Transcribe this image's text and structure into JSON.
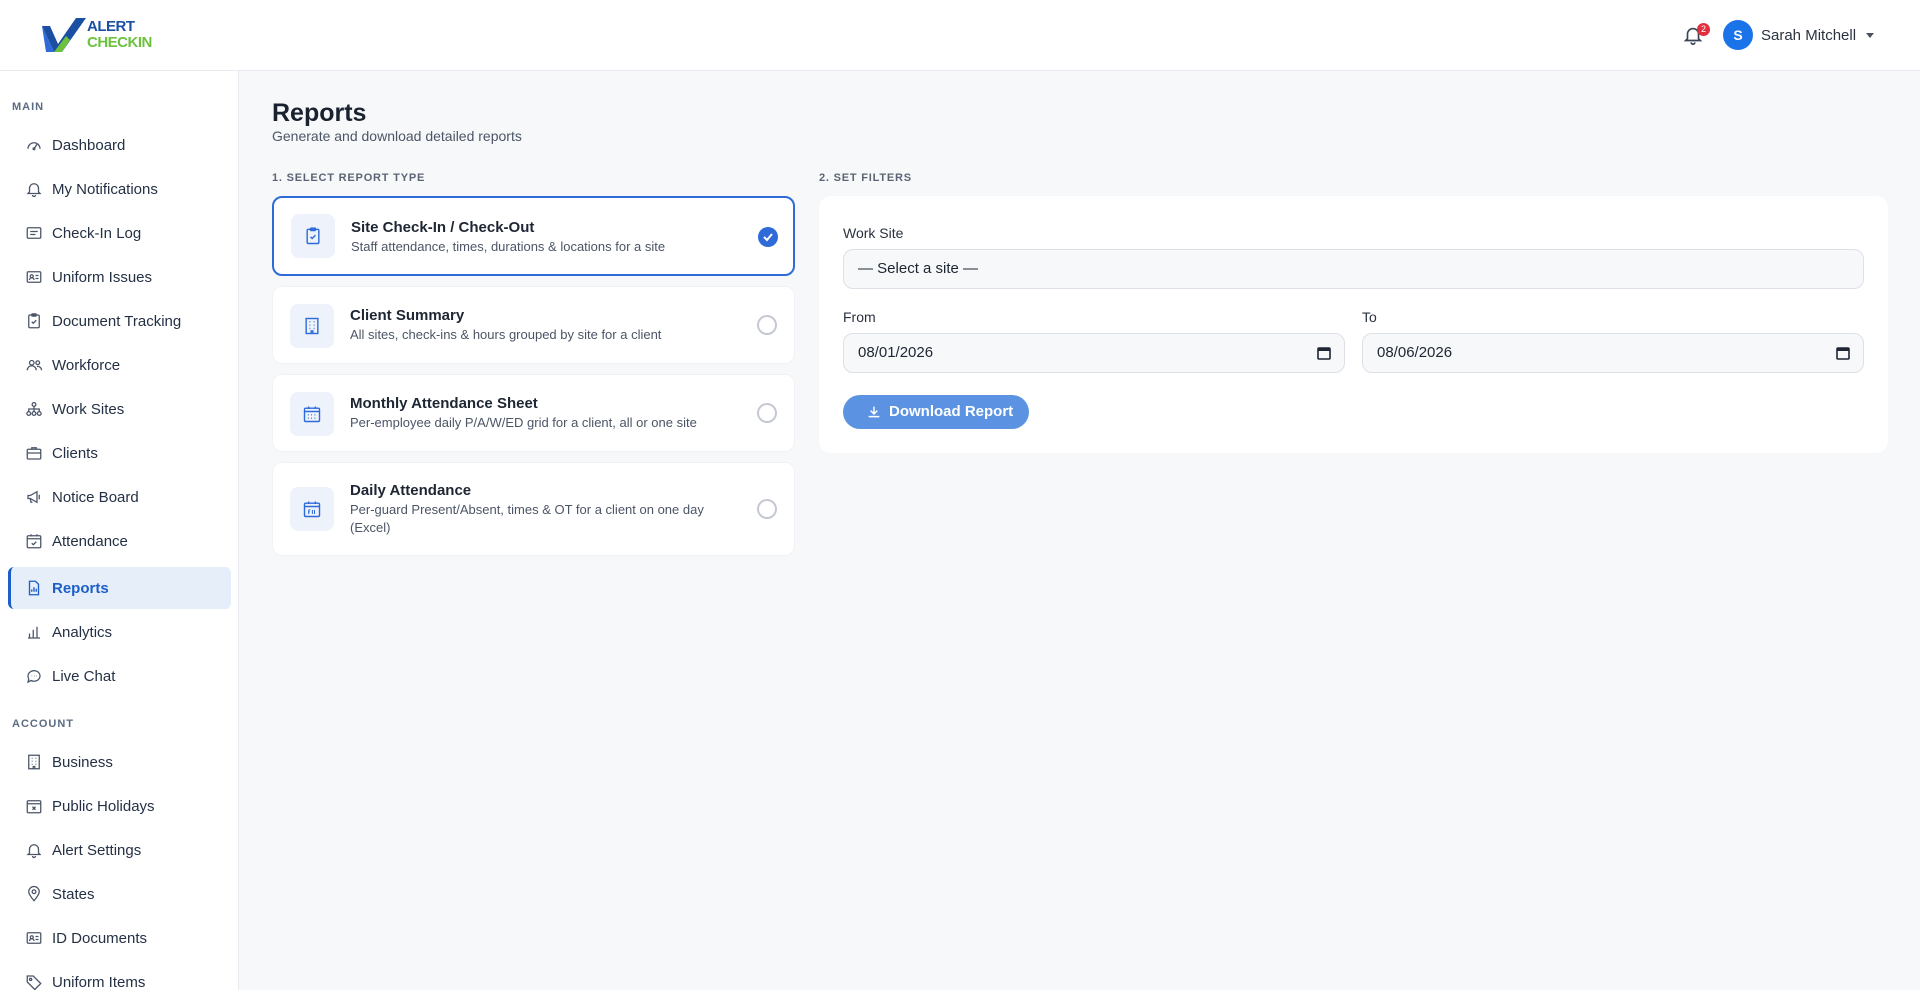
{
  "brand": {
    "line1": "ALERT",
    "line2": "CHECKIN",
    "primary": "#1b4fa3",
    "accent": "#6cc13f"
  },
  "header": {
    "notification_count": "2",
    "user": {
      "initial": "S",
      "name": "Sarah Mitchell"
    }
  },
  "sidebar": {
    "main_heading": "MAIN",
    "main_items": [
      {
        "label": "Dashboard",
        "icon": "gauge-icon"
      },
      {
        "label": "My Notifications",
        "icon": "bell-icon"
      },
      {
        "label": "Check-In Log",
        "icon": "list-card-icon"
      },
      {
        "label": "Uniform Issues",
        "icon": "id-card-icon"
      },
      {
        "label": "Document Tracking",
        "icon": "clipboard-icon"
      },
      {
        "label": "Workforce",
        "icon": "people-icon"
      },
      {
        "label": "Work Sites",
        "icon": "sitemap-icon"
      },
      {
        "label": "Clients",
        "icon": "briefcase-icon"
      },
      {
        "label": "Notice Board",
        "icon": "megaphone-icon"
      },
      {
        "label": "Attendance",
        "icon": "calendar-check-icon"
      },
      {
        "label": "Reports",
        "icon": "report-icon",
        "active": true
      },
      {
        "label": "Analytics",
        "icon": "bar-chart-icon"
      },
      {
        "label": "Live Chat",
        "icon": "chat-icon"
      }
    ],
    "account_heading": "ACCOUNT",
    "account_items": [
      {
        "label": "Business",
        "icon": "building-icon"
      },
      {
        "label": "Public Holidays",
        "icon": "calendar-x-icon"
      },
      {
        "label": "Alert Settings",
        "icon": "bell-icon"
      },
      {
        "label": "States",
        "icon": "map-pin-icon"
      },
      {
        "label": "ID Documents",
        "icon": "id-card-icon"
      },
      {
        "label": "Uniform Items",
        "icon": "tag-icon"
      }
    ]
  },
  "page": {
    "title": "Reports",
    "subtitle": "Generate and download detailed reports",
    "step1_label": "1. SELECT REPORT TYPE",
    "step2_label": "2. SET FILTERS"
  },
  "report_types": [
    {
      "title": "Site Check-In / Check-Out",
      "desc": "Staff attendance, times, durations & locations for a site",
      "icon": "clipboard-check-icon",
      "selected": true
    },
    {
      "title": "Client Summary",
      "desc": "All sites, check-ins & hours grouped by site for a client",
      "icon": "building-icon",
      "selected": false
    },
    {
      "title": "Monthly Attendance Sheet",
      "desc": "Per-employee daily P/A/W/ED grid for a client, all or one site",
      "icon": "calendar-grid-icon",
      "selected": false
    },
    {
      "title": "Daily Attendance",
      "desc": "Per-guard Present/Absent, times & OT for a client on one day (Excel)",
      "icon": "calendar-day-icon",
      "selected": false
    }
  ],
  "filters": {
    "work_site_label": "Work Site",
    "work_site_value": "— Select a site —",
    "from_label": "From",
    "from_value": "08/01/2026",
    "to_label": "To",
    "to_value": "08/06/2026",
    "download_label": "Download Report"
  }
}
